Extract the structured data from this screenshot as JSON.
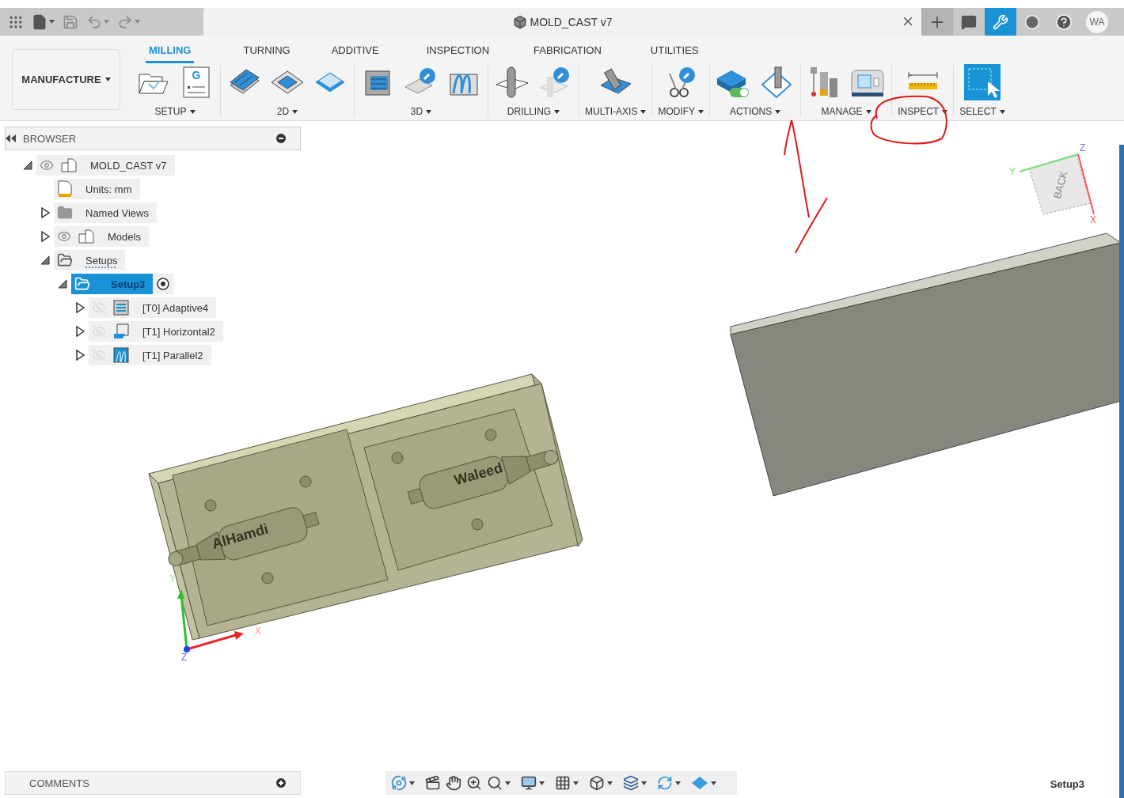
{
  "title_bar": {
    "document_title": "MOLD_CAST v7",
    "user_initials": "WA"
  },
  "ribbon": {
    "workspace": "MANUFACTURE",
    "tabs": [
      {
        "label": "MILLING",
        "selected": true
      },
      {
        "label": "TURNING",
        "selected": false
      },
      {
        "label": "ADDITIVE",
        "selected": false
      },
      {
        "label": "INSPECTION",
        "selected": false
      },
      {
        "label": "FABRICATION",
        "selected": false
      },
      {
        "label": "UTILITIES",
        "selected": false
      }
    ],
    "groups": [
      {
        "label": "SETUP",
        "tools": [
          {
            "kind": "setup"
          },
          {
            "kind": "nc-program",
            "badge": "G"
          }
        ]
      },
      {
        "label": "2D",
        "tools": [
          {
            "kind": "adaptive2d"
          },
          {
            "kind": "pocket"
          },
          {
            "kind": "face"
          }
        ]
      },
      {
        "label": "3D",
        "tools": [
          {
            "kind": "adaptive3d"
          },
          {
            "kind": "probe"
          },
          {
            "kind": "parallel"
          }
        ]
      },
      {
        "label": "DRILLING",
        "tools": [
          {
            "kind": "drill"
          },
          {
            "kind": "hole"
          }
        ]
      },
      {
        "label": "MULTI-AXIS",
        "tools": [
          {
            "kind": "multiaxis"
          }
        ]
      },
      {
        "label": "MODIFY",
        "tools": [
          {
            "kind": "scissors"
          }
        ]
      },
      {
        "label": "ACTIONS",
        "tools": [
          {
            "kind": "simulate"
          },
          {
            "kind": "post"
          }
        ]
      },
      {
        "label": "MANAGE",
        "tools": [
          {
            "kind": "tools"
          },
          {
            "kind": "machine"
          }
        ]
      },
      {
        "label": "INSPECT",
        "tools": [
          {
            "kind": "measure"
          }
        ]
      },
      {
        "label": "SELECT",
        "tools": [
          {
            "kind": "select"
          }
        ]
      }
    ]
  },
  "browser": {
    "title": "BROWSER",
    "tree": [
      {
        "label": "MOLD_CAST v7",
        "kind": "component",
        "expanded": true,
        "visible": true,
        "selected": false,
        "warning": false,
        "children": [
          {
            "label": "Units: mm",
            "kind": "units",
            "selected": false,
            "warning": false
          },
          {
            "label": "Named Views",
            "kind": "folder",
            "expanded": false,
            "selected": false,
            "warning": false
          },
          {
            "label": "Models",
            "kind": "component",
            "expanded": false,
            "visible": true,
            "selected": false,
            "warning": false
          },
          {
            "label": "Setups",
            "kind": "setups",
            "expanded": true,
            "selected": false,
            "warning": true,
            "children": [
              {
                "label": "Setup3",
                "kind": "setup",
                "expanded": true,
                "selected": true,
                "warning": false,
                "active": true,
                "children": [
                  {
                    "label": "[T0] Adaptive4",
                    "kind": "adaptive",
                    "expanded": false,
                    "visible": false,
                    "selected": false,
                    "warning": false
                  },
                  {
                    "label": "[T1] Horizontal2",
                    "kind": "horizontal",
                    "expanded": false,
                    "visible": false,
                    "selected": false,
                    "warning": false
                  },
                  {
                    "label": "[T1] Parallel2",
                    "kind": "parallel",
                    "expanded": false,
                    "visible": false,
                    "selected": false,
                    "warning": false
                  }
                ]
              }
            ]
          }
        ]
      }
    ]
  },
  "viewport": {
    "parts": [
      {
        "engraving": "AlHamdi"
      },
      {
        "engraving": "Waleed"
      }
    ],
    "triad": {
      "x": "X",
      "y": "Y",
      "z": "Z"
    },
    "view_cube": {
      "face": "BACK",
      "x": "X",
      "y": "Y",
      "z": "Z"
    }
  },
  "comments": {
    "title": "COMMENTS"
  },
  "nav_bar": {
    "tools": [
      {
        "kind": "orbit",
        "menu": true
      },
      {
        "kind": "look-at",
        "menu": false
      },
      {
        "kind": "pan",
        "menu": false
      },
      {
        "kind": "zoom",
        "menu": false
      },
      {
        "kind": "fit",
        "menu": true
      },
      {
        "kind": "display",
        "menu": true
      },
      {
        "kind": "grid",
        "menu": true
      },
      {
        "kind": "camera",
        "menu": true
      },
      {
        "kind": "layers",
        "menu": true
      },
      {
        "kind": "refresh",
        "menu": true
      },
      {
        "kind": "effects",
        "menu": true
      }
    ]
  },
  "status": {
    "active_setup": "Setup3"
  }
}
